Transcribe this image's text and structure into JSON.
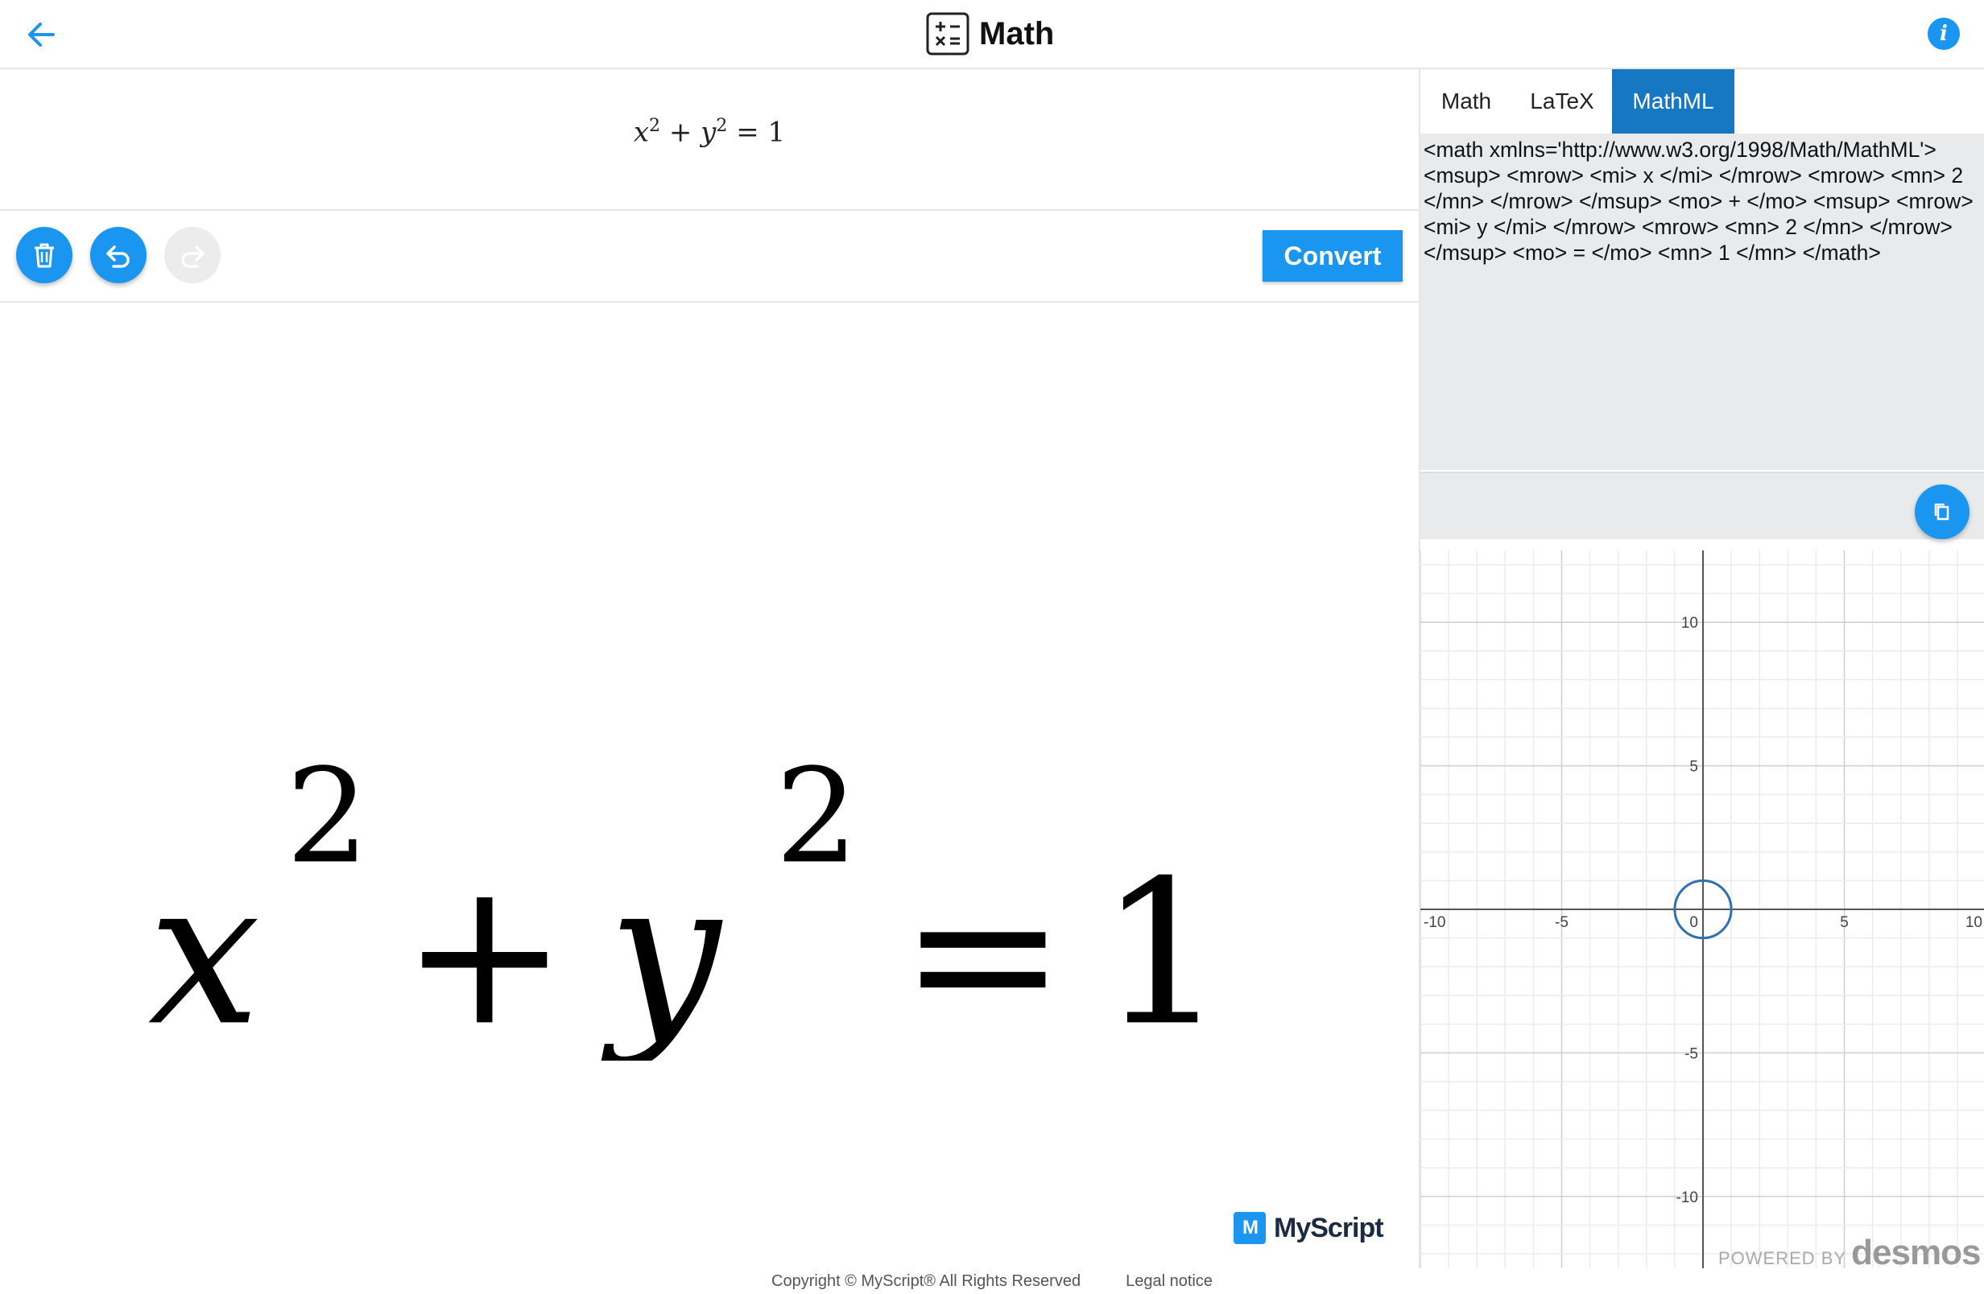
{
  "header": {
    "title": "Math",
    "back_icon": "arrow-left-icon",
    "app_icon": "calculator-icon",
    "info_label": "i"
  },
  "result": {
    "expression": "x² + y² = 1",
    "x": "x",
    "y": "y",
    "plus": "+",
    "equals": "=",
    "one": "1",
    "sup": "2"
  },
  "toolbar": {
    "clear_icon": "trash-icon",
    "undo_icon": "undo-icon",
    "redo_icon": "redo-icon",
    "convert_label": "Convert"
  },
  "canvas": {
    "x": "x",
    "y": "y",
    "plus": "+",
    "equals": "=",
    "one": "1",
    "sup": "2"
  },
  "branding": {
    "myscript_mark": "M",
    "myscript_word": "MyScript",
    "myscript_tm": "."
  },
  "tabs": [
    {
      "label": "Math",
      "active": false
    },
    {
      "label": "LaTeX",
      "active": false
    },
    {
      "label": "MathML",
      "active": true
    }
  ],
  "code": {
    "mathml": "<math xmlns='http://www.w3.org/1998/Math/MathML'> <msup> <mrow> <mi> x </mi> </mrow> <mrow> <mn> 2 </mn> </mrow> </msup> <mo> + </mo> <msup> <mrow> <mi> y </mi> </mrow> <mrow> <mn> 2 </mn> </mrow> </msup> <mo> = </mo> <mn> 1 </mn> </math>",
    "copy_icon": "copy-icon"
  },
  "graph": {
    "x_range": [
      -10,
      10
    ],
    "y_range": [
      -12.5,
      12.5
    ],
    "x_ticks": [
      "-10",
      "-5",
      "0",
      "5",
      "10"
    ],
    "y_ticks": [
      "10",
      "5",
      "-5",
      "-10"
    ],
    "curve": {
      "type": "circle",
      "center": [
        0,
        0
      ],
      "radius": 1,
      "color": "#2d70b3"
    },
    "credit_powered": "POWERED BY",
    "credit_brand": "desmos"
  },
  "footer": {
    "copyright": "Copyright © MyScript® All Rights Reserved",
    "legal": "Legal notice"
  },
  "colors": {
    "accent": "#1a96f0",
    "tab_active": "#1677c3",
    "code_bg": "#e9eaeb"
  }
}
